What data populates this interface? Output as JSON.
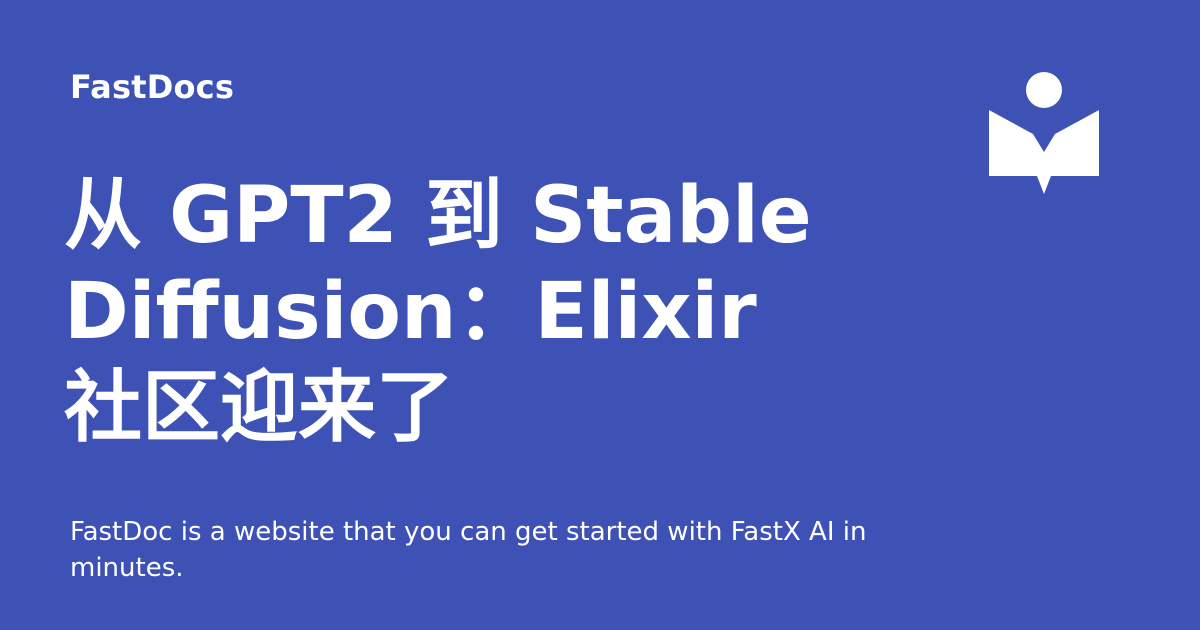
{
  "brand": {
    "name": "FastDocs",
    "icon": "book-reader-icon"
  },
  "hero": {
    "title_lines": [
      "从 GPT2 到 Stable",
      "Diffusion：Elixir",
      "社区迎来了"
    ],
    "description": "FastDoc is a website that you can get started with FastX AI in minutes."
  },
  "colors": {
    "background": "#3e51b5",
    "text": "#ffffff",
    "icon": "#ffffff"
  }
}
